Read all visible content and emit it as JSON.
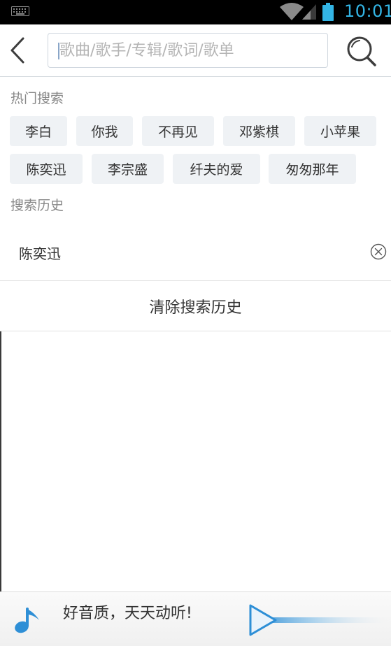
{
  "status_bar": {
    "time": "10:01",
    "icons": [
      "keyboard-icon",
      "wifi-icon",
      "signal-icon",
      "battery-icon"
    ],
    "accent_color": "#33b5e5"
  },
  "search": {
    "placeholder": "歌曲/歌手/专辑/歌词/歌单",
    "value": "",
    "back_icon": "back-arrow-icon",
    "search_icon": "search-icon"
  },
  "hot_search": {
    "title": "热门搜索",
    "tags": [
      "李白",
      "你我",
      "不再见",
      "邓紫棋",
      "小苹果",
      "陈奕迅",
      "李宗盛",
      "纤夫的爱",
      "匆匆那年"
    ]
  },
  "history": {
    "title": "搜索历史",
    "items": [
      "陈奕迅"
    ],
    "clear_label": "清除搜索历史"
  },
  "player": {
    "slogan": "好音质，天天动听!",
    "icon": "music-note-icon",
    "play_icon": "play-icon",
    "brand_color": "#2e8fd6"
  }
}
